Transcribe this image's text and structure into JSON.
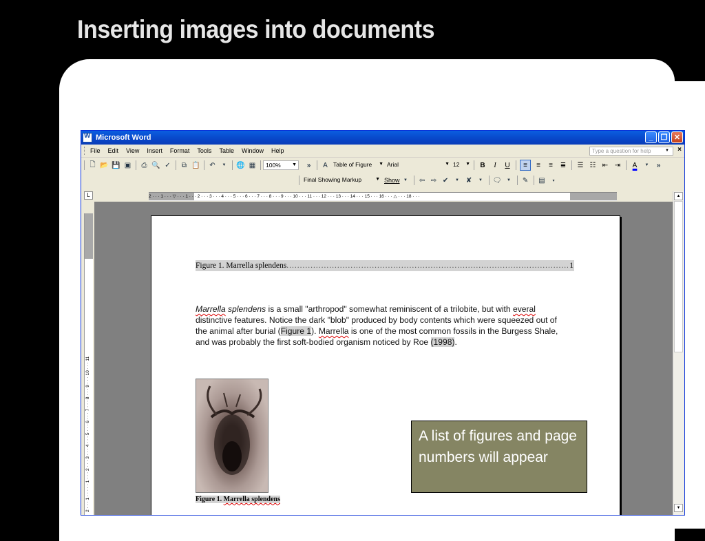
{
  "slide": {
    "title": "Inserting images into documents"
  },
  "window": {
    "title": "Microsoft Word",
    "minimize": "_",
    "restore": "❐",
    "close": "✕"
  },
  "menubar": {
    "items": [
      "File",
      "Edit",
      "View",
      "Insert",
      "Format",
      "Tools",
      "Table",
      "Window",
      "Help"
    ],
    "help_placeholder": "Type a question for help",
    "doc_close": "×"
  },
  "toolbar": {
    "zoom": "100%",
    "style": "Table of Figure",
    "font": "Arial",
    "size": "12",
    "bold": "B",
    "italic": "I",
    "underline": "U",
    "more": "»"
  },
  "reviewing": {
    "display": "Final Showing Markup",
    "show": "Show"
  },
  "ruler": {
    "horizontal": "2 · · · 1 · · · ▽ · · · 1 · · · 2 · · · 3 · · · 4 · · · 5 · · · 6 · · · 7 · · · 8 · · · 9 · · · 10 · · · 11 · · · 12 · · · 13 · · · 14 · · · 15 · · · 16 · · · △ · · · 18 · · ·",
    "vertical": "2 · · · 1 · · · · · 1 · · · 2 · · · 3 · · · 4 · · · 5 · · · 6 · · · 7 · · · 8 · · · 9 · · · 10 · · · 11"
  },
  "document": {
    "tof_entry": "Figure 1. Marrella splendens",
    "tof_dots": "..........................................................................................................................",
    "tof_page": "1",
    "para": {
      "w1": "Marrella",
      "w2": " splendens",
      "t1": " is a small \"arthropod\" somewhat reminiscent of a trilobite, but with ",
      "w3": "everal",
      "t2": " distinctive features. Notice the dark \"blob\" produced by body contents which were squeezed out of the animal after burial (",
      "ref": "Figure 1",
      "t3": ").  ",
      "w4": "Marrella",
      "t4": " is one of the most common fossils in the Burgess Shale, and was probably the first soft-bodied organism noticed by Roe ",
      "year": "(1998)",
      "t5": "."
    },
    "caption_prefix": "Figure 1. ",
    "caption_name": "Marrella splendens"
  },
  "callout": {
    "text": "A list of figures and page numbers will appear"
  }
}
